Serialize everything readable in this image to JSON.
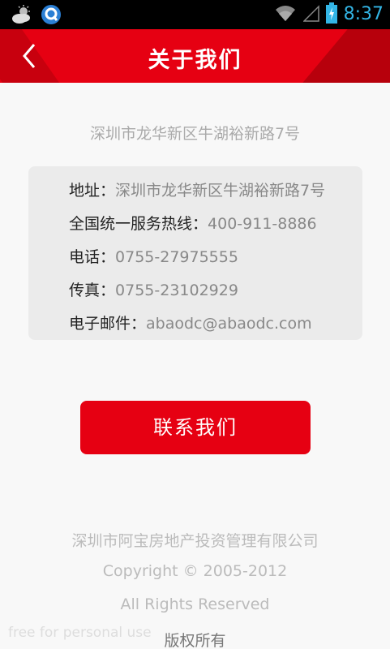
{
  "status_bar": {
    "time": "8:37",
    "icons": [
      "weather-cloud-icon",
      "app-q-icon",
      "wifi-icon",
      "signal-icon",
      "battery-charging-icon"
    ],
    "time_color": "#33b5e5"
  },
  "header": {
    "title": "关于我们",
    "back_icon": "chevron-left-icon",
    "accent": "#e60012"
  },
  "main": {
    "address_line": "深圳市龙华新区牛湖裕新路7号",
    "info": [
      {
        "label": "地址：",
        "value": "深圳市龙华新区牛湖裕新路7号"
      },
      {
        "label": "全国统一服务热线：",
        "value": "400-911-8886"
      },
      {
        "label": "电话：",
        "value": "0755-27975555"
      },
      {
        "label": "传真：",
        "value": "0755-23102929"
      },
      {
        "label": "电子邮件：",
        "value": "abaodc@abaodc.com"
      }
    ],
    "contact_button": "联系我们"
  },
  "footer": {
    "company": "深圳市阿宝房地产投资管理有限公司",
    "copyright": "Copyright © 2005-2012",
    "rights": "All Rights Reserved",
    "owned": "版权所有",
    "watermark": "free for personal use"
  }
}
